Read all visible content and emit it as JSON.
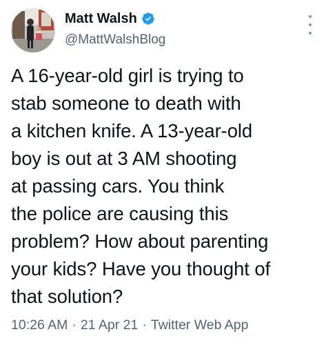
{
  "tweet": {
    "author": {
      "display_name": "Matt Walsh",
      "handle": "@MattWalshBlog",
      "verified": true,
      "avatar_icon": "avatar-photo"
    },
    "menu_icon": "more-vertical-icon",
    "text_lines": [
      "A 16-year-old girl is trying to",
      "stab someone to death with",
      "a kitchen knife. A 13-year-old",
      "boy is out at 3 AM shooting",
      "at passing cars. You think",
      "the police are causing this",
      "problem? How about parenting",
      "your kids? Have you thought of",
      "that solution?"
    ],
    "time": "10:26 AM",
    "date": "21 Apr 21",
    "source": "Twitter Web App",
    "separator": "·"
  },
  "colors": {
    "text_primary": "#0f1419",
    "text_secondary": "#536471",
    "verified_blue": "#1d9bf0",
    "background": "#ffffff"
  }
}
